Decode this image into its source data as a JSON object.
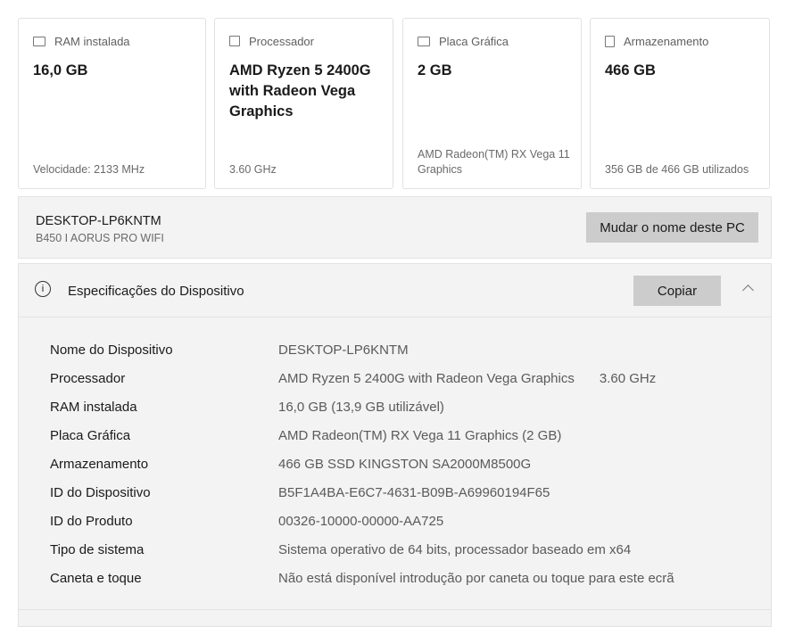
{
  "cards": [
    {
      "icon": "memory-icon",
      "label": "RAM instalada",
      "value": "16,0 GB",
      "sub": "Velocidade: 2133 MHz"
    },
    {
      "icon": "processor-icon",
      "label": "Processador",
      "value": "AMD Ryzen 5 2400G with Radeon Vega Graphics",
      "sub": "3.60 GHz"
    },
    {
      "icon": "graphics-card-icon",
      "label": "Placa Gráfica",
      "value": "2 GB",
      "sub": "AMD Radeon(TM) RX Vega 11 Graphics"
    },
    {
      "icon": "storage-icon",
      "label": "Armazenamento",
      "value": "466 GB",
      "sub": "356 GB de 466 GB utilizados"
    }
  ],
  "device": {
    "name": "DESKTOP-LP6KNTM",
    "model": "B450 I AORUS PRO WIFI",
    "rename_label": "Mudar o nome deste PC"
  },
  "specs": {
    "title": "Especificações do Dispositivo",
    "copy_label": "Copiar",
    "rows": [
      {
        "k": "Nome do Dispositivo",
        "v": "DESKTOP-LP6KNTM"
      },
      {
        "k": "Processador",
        "v": "AMD Ryzen 5 2400G with Radeon Vega Graphics",
        "v2": "3.60 GHz"
      },
      {
        "k": "RAM instalada",
        "v": "16,0 GB (13,9 GB utilizável)"
      },
      {
        "k": "Placa Gráfica",
        "v": "AMD Radeon(TM) RX Vega 11 Graphics (2 GB)"
      },
      {
        "k": "Armazenamento",
        "v": "466 GB SSD KINGSTON SA2000M8500G"
      },
      {
        "k": "ID do Dispositivo",
        "v": "B5F1A4BA-E6C7-4631-B09B-A69960194F65"
      },
      {
        "k": "ID do Produto",
        "v": "00326-10000-00000-AA725"
      },
      {
        "k": "Tipo de sistema",
        "v": "Sistema operativo de 64 bits, processador baseado em x64"
      },
      {
        "k": "Caneta e toque",
        "v": "Não está disponível introdução por caneta ou toque para este ecrã"
      }
    ]
  }
}
